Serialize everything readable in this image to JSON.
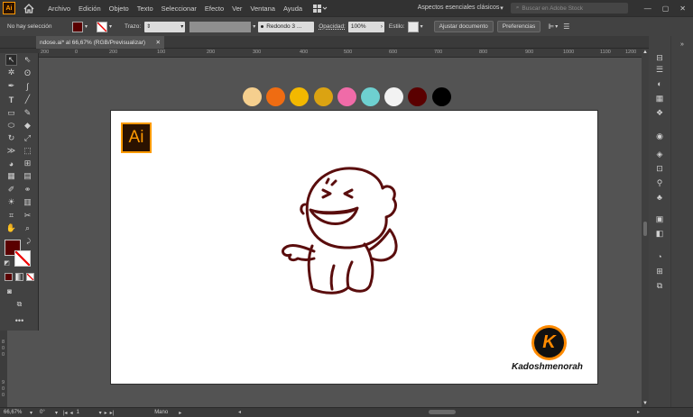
{
  "app": {
    "logo": "Ai",
    "menu": [
      "Archivo",
      "Edición",
      "Objeto",
      "Texto",
      "Seleccionar",
      "Efecto",
      "Ver",
      "Ventana",
      "Ayuda"
    ],
    "workspace": "Aspectos esenciales clásicos",
    "stock_placeholder": "Buscar en Adobe Stock"
  },
  "control_bar": {
    "selection_label": "No hay selección",
    "stroke_label": "Trazo:",
    "brush_value": "Redondo 3 ...",
    "opacity_label": "Opacidad:",
    "opacity_value": "100%",
    "style_label": "Estilo:",
    "adjust_doc_button": "Ajustar documento",
    "preferences_button": "Preferencias",
    "fill_color": "#5a0000"
  },
  "document": {
    "tab_title": "ndose.ai* al 66,67% (RGB/Previsualizar)"
  },
  "ruler": {
    "h_ticks": [
      "200",
      "0",
      "200",
      "100",
      "200",
      "300",
      "400",
      "500",
      "600",
      "700",
      "800",
      "900",
      "1000",
      "1100",
      "1200",
      "1300",
      "1400"
    ],
    "v_ticks": [
      "8",
      "0",
      "0",
      "9",
      "0",
      "0"
    ]
  },
  "palette": [
    "#f5cf8e",
    "#ef6c12",
    "#f3b800",
    "#dba312",
    "#f06ba8",
    "#6ed0d0",
    "#f2f2f2",
    "#5a0000",
    "#000000"
  ],
  "artboard": {
    "badge": "Ai",
    "watermark_letter": "K",
    "watermark_text": "Kadoshmenorah"
  },
  "status": {
    "zoom": "66,67%",
    "angle": "0°",
    "page": "1",
    "tool": "Mano"
  }
}
